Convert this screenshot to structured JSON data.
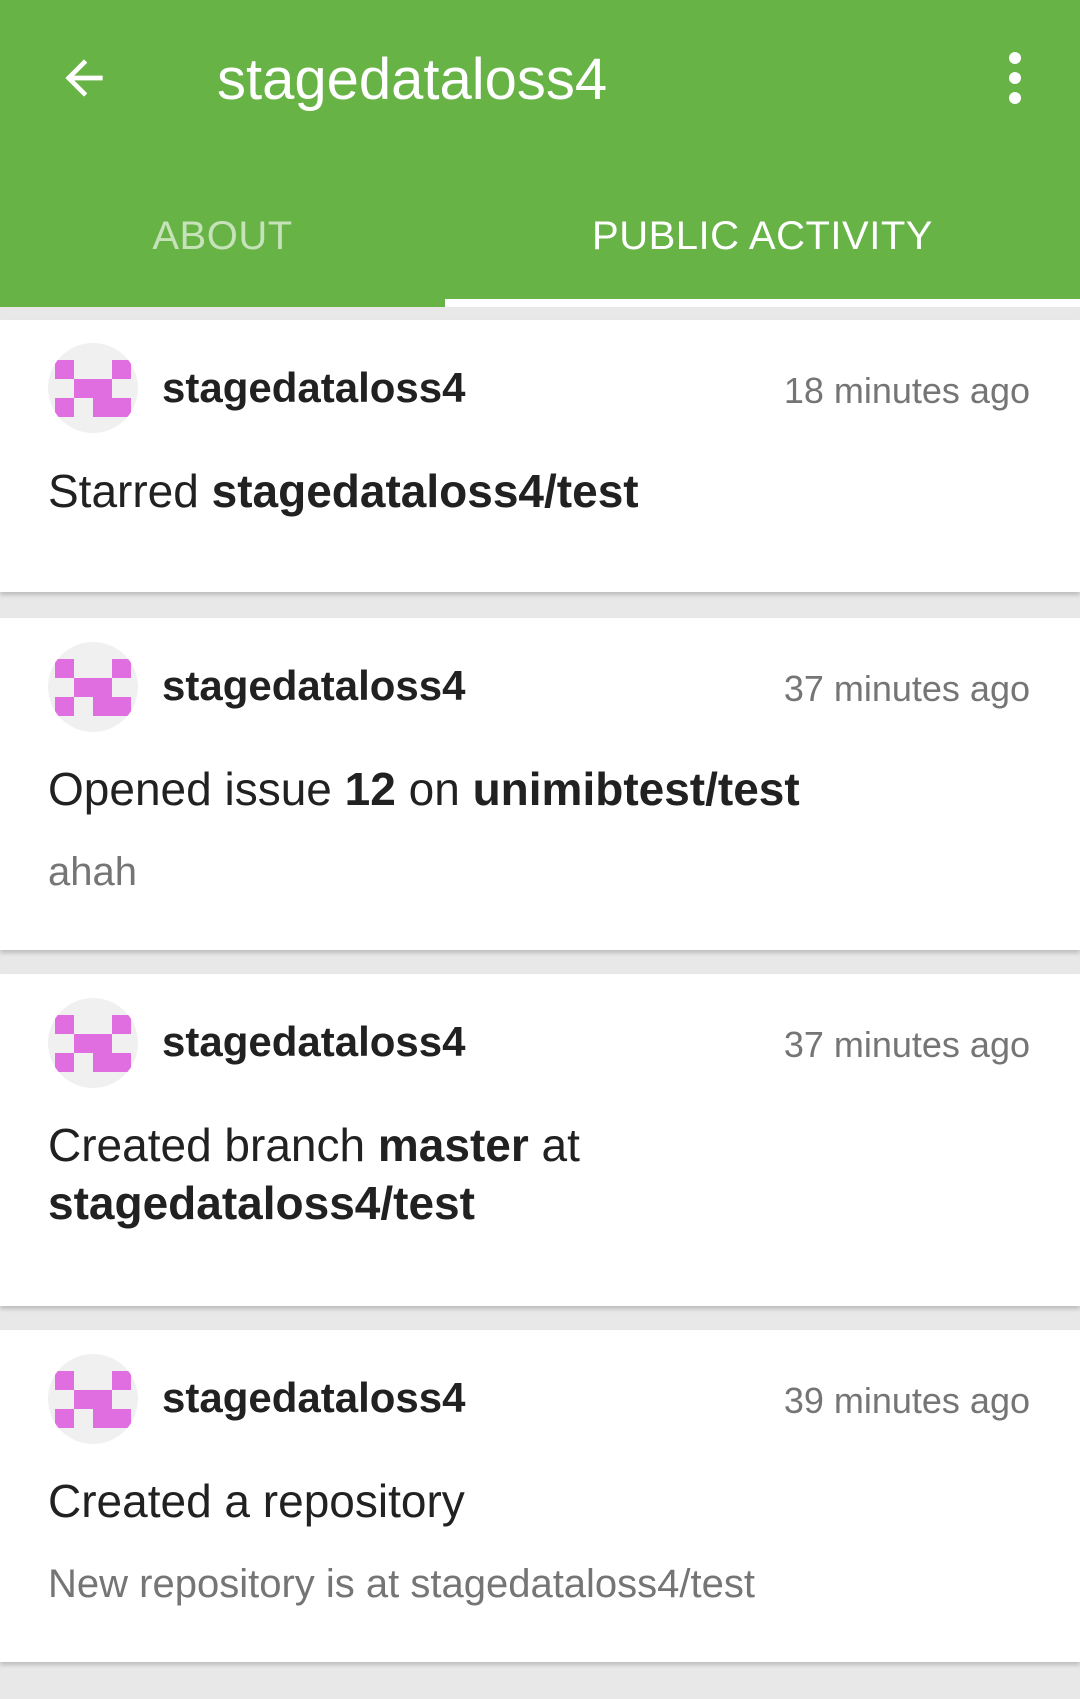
{
  "app_bar": {
    "back_icon": "arrow-back-icon",
    "title": "stagedataloss4",
    "menu_icon": "more-vert-icon",
    "color": "#67b346"
  },
  "tabs": [
    {
      "label": "ABOUT",
      "selected": false
    },
    {
      "label": "PUBLIC ACTIVITY",
      "selected": true
    }
  ],
  "events": [
    {
      "user": "stagedataloss4",
      "time": "18 minutes ago",
      "text": {
        "t1": "Starred ",
        "b1": "stagedataloss4/test"
      },
      "description": ""
    },
    {
      "user": "stagedataloss4",
      "time": "37 minutes ago",
      "text": {
        "t1": "Opened issue ",
        "b1": "12",
        "t2": " on ",
        "b2": "unimibtest/test"
      },
      "description": "ahah"
    },
    {
      "user": "stagedataloss4",
      "time": "37 minutes ago",
      "text": {
        "t1": "Created branch ",
        "b1": "master",
        "t2": " at ",
        "b2": "stagedataloss4/test"
      },
      "description": ""
    },
    {
      "user": "stagedataloss4",
      "time": "39 minutes ago",
      "text": {
        "t1": "Created a repository"
      },
      "description": "New repository is at stagedataloss4/test"
    }
  ],
  "colors": {
    "avatar_pattern": "#e06ee0",
    "avatar_background": "#f0f0f0"
  }
}
